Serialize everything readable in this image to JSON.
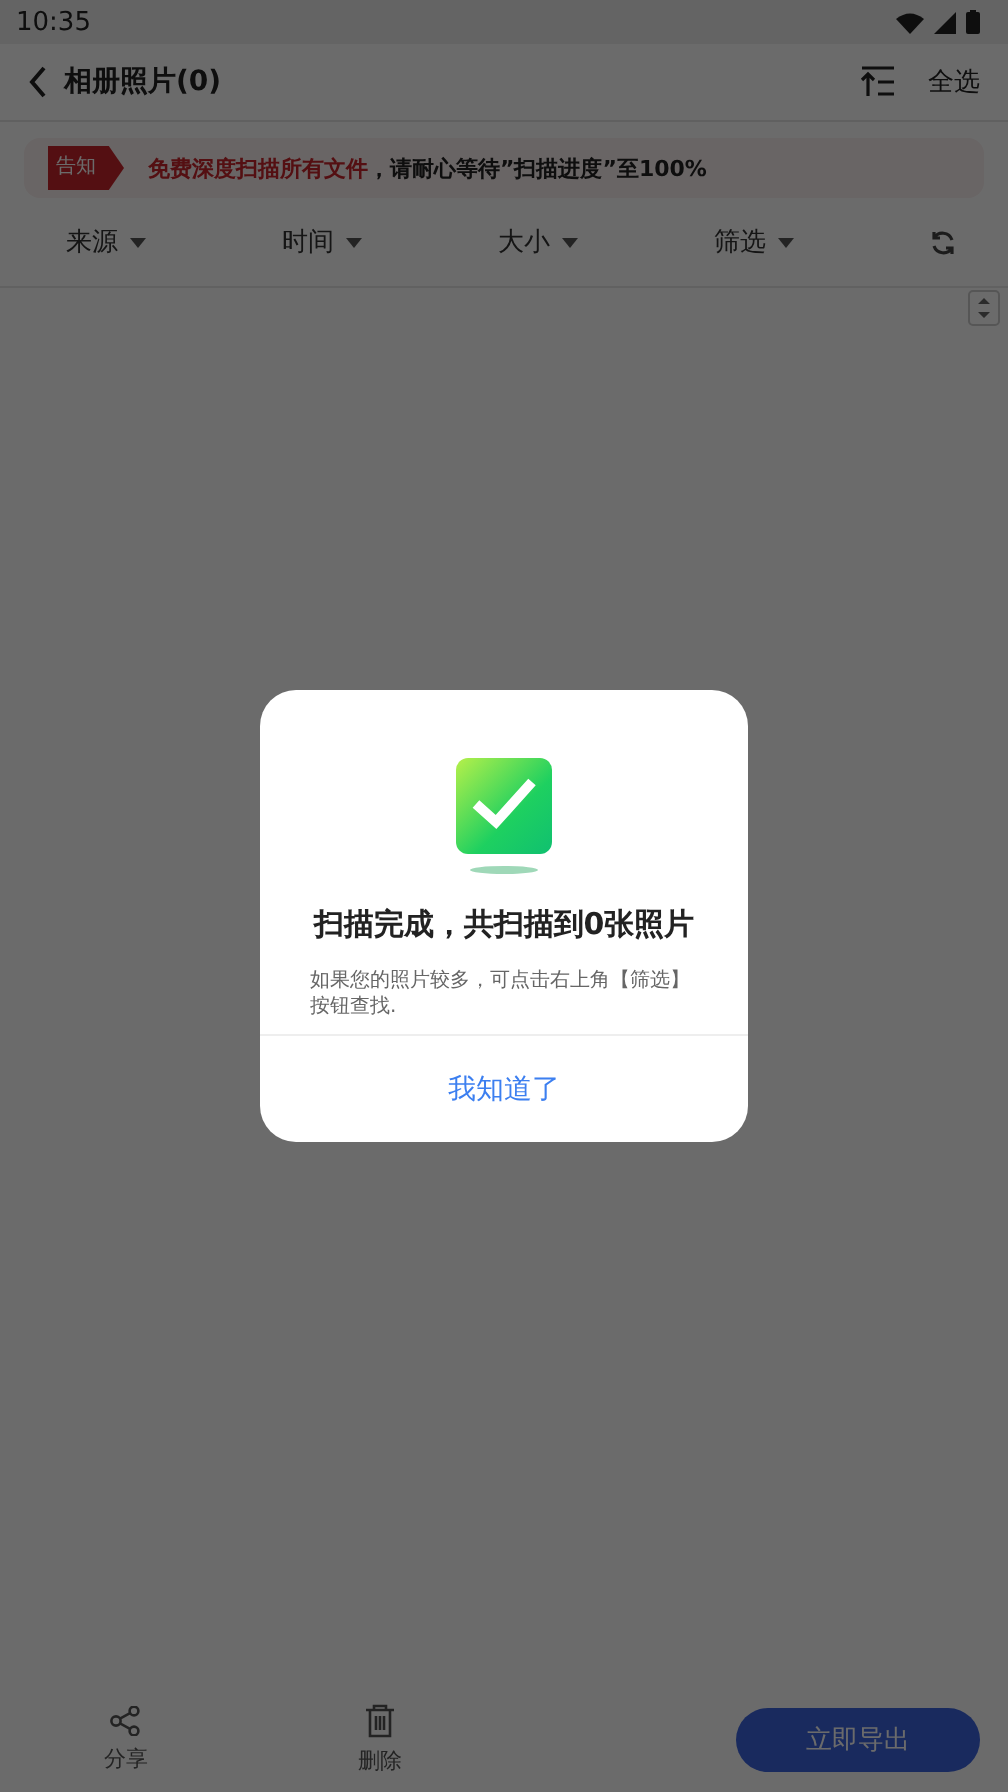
{
  "status_bar": {
    "time": "10:35"
  },
  "header": {
    "title": "相册照片(0)",
    "select_all": "全选"
  },
  "notice": {
    "tag": "告知",
    "highlight": "免费深度扫描所有文件",
    "text": "，请耐心等待”扫描进度”至100%"
  },
  "filters": [
    {
      "label": "来源"
    },
    {
      "label": "时间"
    },
    {
      "label": "大小"
    },
    {
      "label": "筛选"
    }
  ],
  "dialog": {
    "title": "扫描完成，共扫描到0张照片",
    "message": "如果您的照片较多，可点击右上角【筛选】按钮查找.",
    "button": "我知道了"
  },
  "bottom_bar": {
    "actions": [
      {
        "kind": "share",
        "label": "分享"
      },
      {
        "kind": "delete",
        "label": "删除"
      }
    ],
    "export_button": "立即导出"
  }
}
